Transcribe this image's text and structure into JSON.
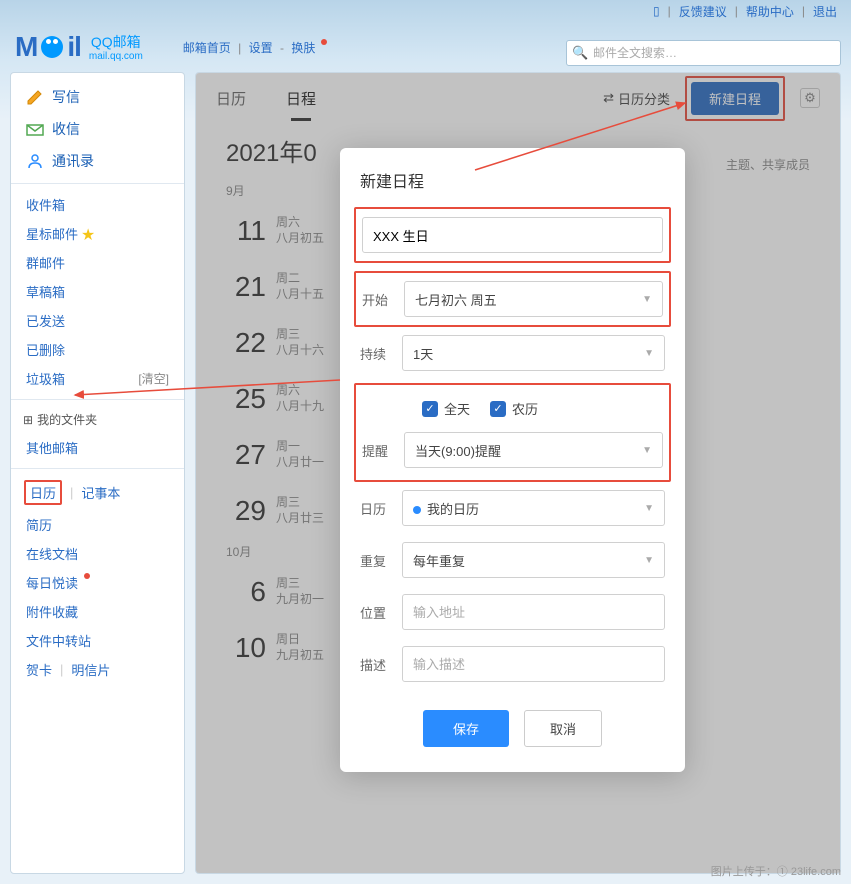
{
  "topbar": {
    "feedback": "反馈建议",
    "help": "帮助中心",
    "logout": "退出"
  },
  "logo": {
    "brand": "QQ邮箱",
    "domain": "mail.qq.com"
  },
  "topnav": {
    "home": "邮箱首页",
    "settings": "设置",
    "skin": "换肤"
  },
  "search": {
    "placeholder": "邮件全文搜索…"
  },
  "sidebar": {
    "compose": "写信",
    "receive": "收信",
    "contacts": "通讯录",
    "inbox": "收件箱",
    "starred": "星标邮件",
    "group": "群邮件",
    "drafts": "草稿箱",
    "sent": "已发送",
    "deleted": "已删除",
    "trash": "垃圾箱",
    "clear": "[清空]",
    "myfolders": "我的文件夹",
    "other": "其他邮箱",
    "calendar": "日历",
    "notebook": "记事本",
    "resume": "简历",
    "docs": "在线文档",
    "daily": "每日悦读",
    "attach": "附件收藏",
    "filestation": "文件中转站",
    "card": "贺卡",
    "postcard": "明信片"
  },
  "tabs": {
    "cal": "日历",
    "schedule": "日程",
    "caltype": "日历分类",
    "newbtn": "新建日程"
  },
  "calheader": {
    "title": "2021年0",
    "sub": "主题、共享成员"
  },
  "months": {
    "sep": "9月",
    "oct": "10月"
  },
  "events": [
    {
      "day": "11",
      "wd": "周六",
      "lunar": "八月初五"
    },
    {
      "day": "21",
      "wd": "周二",
      "lunar": "八月十五"
    },
    {
      "day": "22",
      "wd": "周三",
      "lunar": "八月十六"
    },
    {
      "day": "25",
      "wd": "周六",
      "lunar": "八月十九"
    },
    {
      "day": "27",
      "wd": "周一",
      "lunar": "八月廿一"
    },
    {
      "day": "29",
      "wd": "周三",
      "lunar": "八月廿三"
    },
    {
      "day": "6",
      "wd": "周三",
      "lunar": "九月初一"
    },
    {
      "day": "10",
      "wd": "周日",
      "lunar": "九月初五"
    }
  ],
  "modal": {
    "title": "新建日程",
    "subject": "XXX 生日",
    "start_label": "开始",
    "start_val": "七月初六 周五",
    "duration_label": "持续",
    "duration_val": "1天",
    "allday": "全天",
    "lunar": "农历",
    "remind_label": "提醒",
    "remind_val": "当天(9:00)提醒",
    "cal_label": "日历",
    "cal_val": "我的日历",
    "repeat_label": "重复",
    "repeat_val": "每年重复",
    "loc_label": "位置",
    "loc_placeholder": "输入地址",
    "desc_label": "描述",
    "desc_placeholder": "输入描述",
    "save": "保存",
    "cancel": "取消"
  },
  "watermark": "图片上传于：① 23life.com"
}
